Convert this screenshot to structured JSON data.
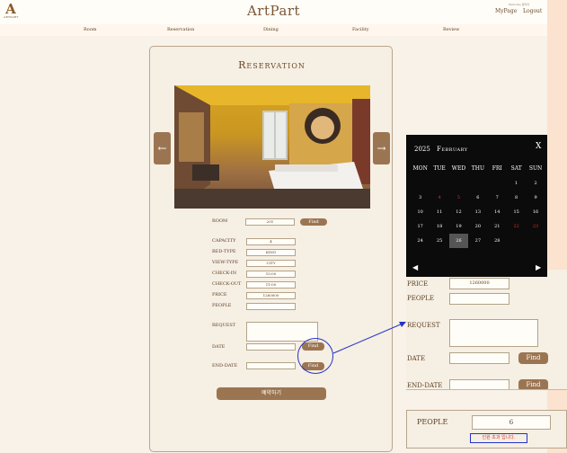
{
  "header": {
    "logo_text": "ARTPART",
    "title": "ArtPart",
    "welcome": "Welcome 관리자",
    "mypage": "MyPage",
    "logout": "Logout"
  },
  "nav": [
    "Room",
    "Reservation",
    "Dining",
    "Facility",
    "Review"
  ],
  "reservation": {
    "title": "Reservation",
    "labels": {
      "room": "ROOM",
      "capacity": "CAPACITY",
      "bed_type": "BED-TYPE",
      "view_type": "VIEW-TYPE",
      "check_in": "CHECK-IN",
      "check_out": "CHECK-OUT",
      "price": "PRICE",
      "people": "PEOPLE",
      "request": "REQUEST",
      "date": "DATE",
      "end_date": "END-DATE"
    },
    "values": {
      "room": "201",
      "capacity": "4",
      "bed_type": "KING",
      "view_type": "CITY",
      "check_in": "15:00",
      "check_out": "11:00",
      "price": "1260000",
      "people": ""
    },
    "find_label": "Find",
    "submit_label": "예약하기",
    "prev_arrow": "←",
    "next_arrow": "→"
  },
  "calendar": {
    "year": "2025",
    "month": "February",
    "close": "X",
    "weekdays": [
      "MON",
      "TUE",
      "WED",
      "THU",
      "FRI",
      "SAT",
      "SUN"
    ],
    "weeks": [
      [
        "",
        "",
        "",
        "",
        "",
        "1",
        "2"
      ],
      [
        "3",
        "4",
        "5",
        "6",
        "7",
        "8",
        "9"
      ],
      [
        "10",
        "11",
        "12",
        "13",
        "14",
        "15",
        "16"
      ],
      [
        "17",
        "18",
        "19",
        "20",
        "21",
        "22",
        "23"
      ],
      [
        "24",
        "25",
        "26",
        "27",
        "28",
        "",
        ""
      ]
    ],
    "red_days": [
      "4",
      "5",
      "22",
      "23"
    ],
    "selected_day": "26",
    "prev": "◀",
    "next": "▶"
  },
  "zoom_form": {
    "price_label": "PRICE",
    "price_value": "1260000",
    "people_label": "PEOPLE",
    "request_label": "REQUEST",
    "date_label": "DATE",
    "end_date_label": "END-DATE",
    "find_label": "Find"
  },
  "people_popup": {
    "label": "PEOPLE",
    "value": "6",
    "warning": "인원 초과 입니다."
  },
  "colors": {
    "accent": "#9b7552",
    "annotation": "#2333c8",
    "warning": "#e03030"
  }
}
